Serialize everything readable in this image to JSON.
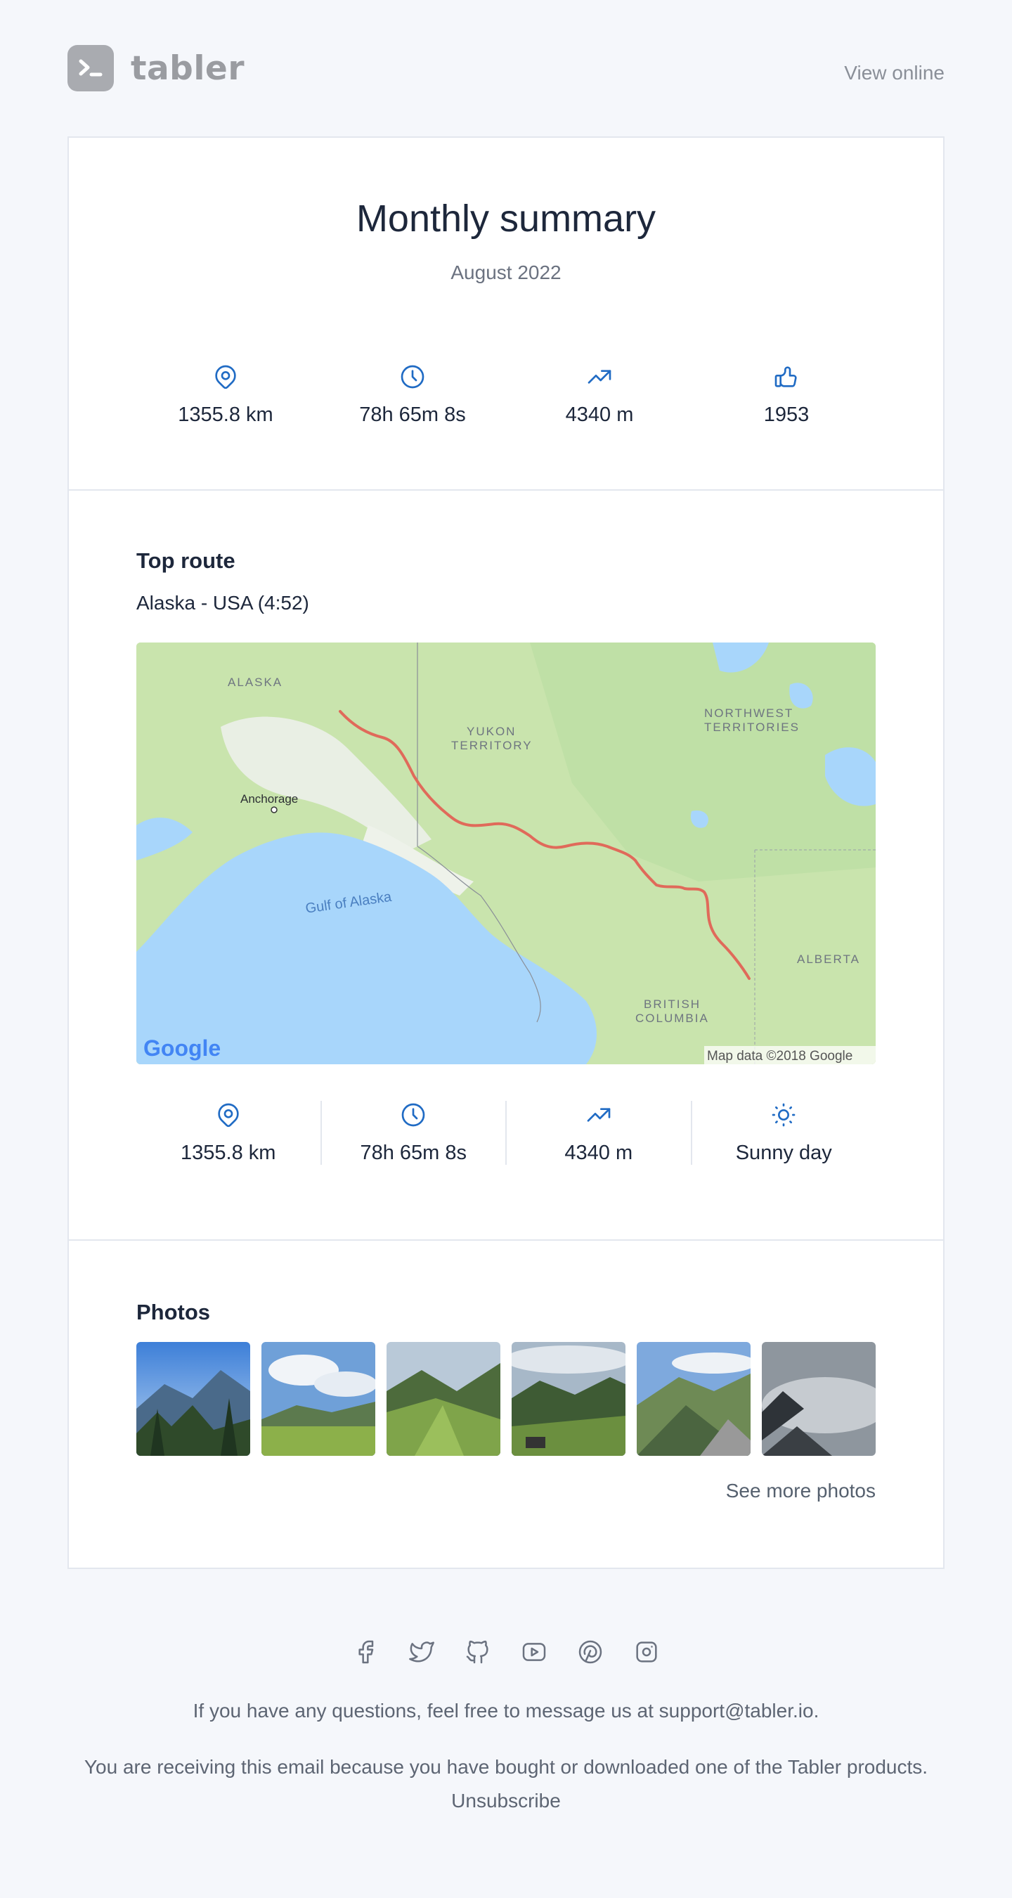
{
  "header": {
    "logo_text": "tabler",
    "view_online": "View online"
  },
  "summary": {
    "title": "Monthly summary",
    "period": "August 2022",
    "stats": [
      {
        "icon": "map-pin-icon",
        "value": "1355.8 km"
      },
      {
        "icon": "clock-icon",
        "value": "78h 65m 8s"
      },
      {
        "icon": "trending-up-icon",
        "value": "4340 m"
      },
      {
        "icon": "thumb-up-icon",
        "value": "1953"
      }
    ]
  },
  "top_route": {
    "heading": "Top route",
    "route": "Alaska - USA (4:52)",
    "map": {
      "labels": [
        "ALASKA",
        "YUKON",
        "TERRITORY",
        "NORTHWEST",
        "TERRITORIES",
        "Anchorage",
        "Gulf of Alaska",
        "ALBERTA",
        "BRITISH",
        "COLUMBIA"
      ],
      "attribution": "Map data ©2018 Google",
      "brand": "Google"
    },
    "stats": [
      {
        "icon": "map-pin-icon",
        "value": "1355.8 km"
      },
      {
        "icon": "clock-icon",
        "value": "78h 65m 8s"
      },
      {
        "icon": "trending-up-icon",
        "value": "4340 m"
      },
      {
        "icon": "sun-icon",
        "value": "Sunny day"
      }
    ]
  },
  "photos": {
    "heading": "Photos",
    "see_more": "See more photos"
  },
  "footer": {
    "social": [
      "facebook-icon",
      "twitter-icon",
      "github-icon",
      "youtube-icon",
      "pinterest-icon",
      "instagram-icon"
    ],
    "questions": "If you have any questions, feel free to message us at support@tabler.io.",
    "reason": "You are receiving this email because you have bought or downloaded one of the Tabler products.",
    "unsubscribe": "Unsubscribe"
  },
  "colors": {
    "accent": "#206bc4",
    "route": "#e06a5a",
    "page_bg": "#f5f7fb"
  }
}
